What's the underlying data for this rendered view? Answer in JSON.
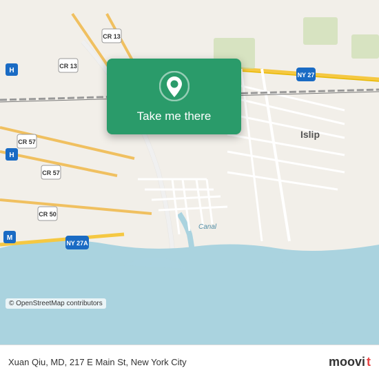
{
  "map": {
    "attribution": "© OpenStreetMap contributors",
    "background_color": "#e8e0d8"
  },
  "action_card": {
    "button_label": "Take me there",
    "pin_color": "white"
  },
  "bottom_bar": {
    "location_text": "Xuan Qiu, MD, 217 E Main St, New York City",
    "logo_part1": "moovi",
    "logo_part2": "t"
  },
  "road_labels": [
    "CR 13",
    "CR 13",
    "CR 57",
    "CR 57",
    "CR 50",
    "NY 27",
    "NY 27A",
    "Islip",
    "Canal"
  ]
}
